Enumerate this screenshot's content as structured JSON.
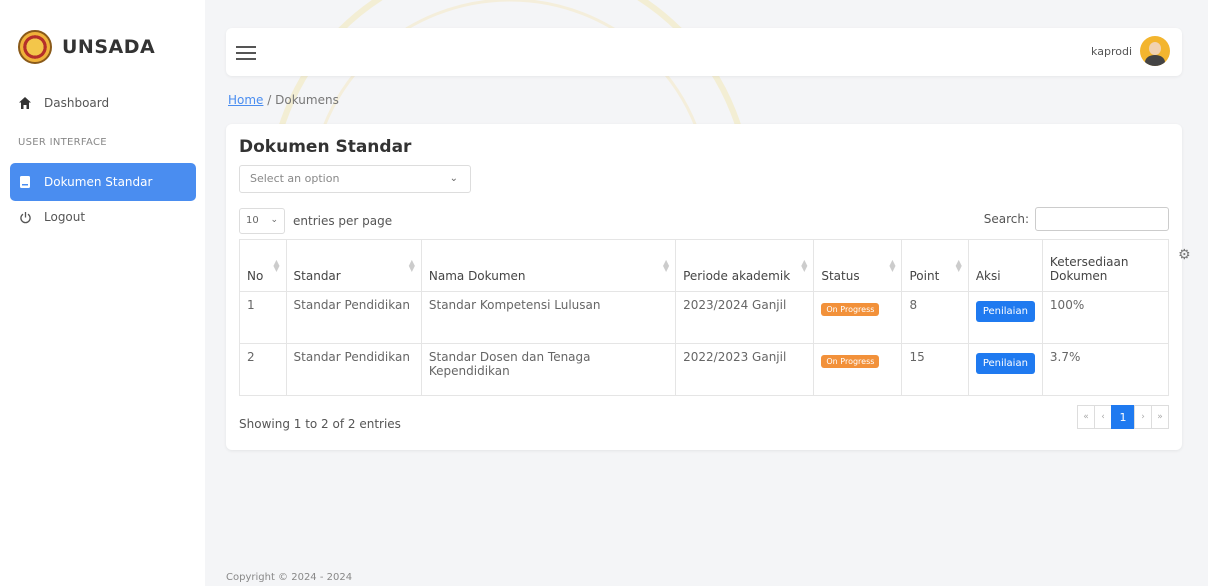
{
  "sidebar": {
    "brand": "UNSADA",
    "items": [
      {
        "label": "Dashboard"
      },
      {
        "label": "Dokumen Standar"
      },
      {
        "label": "Logout"
      }
    ],
    "section": "USER INTERFACE"
  },
  "topbar": {
    "user": "kaprodi"
  },
  "breadcrumb": {
    "home": "Home",
    "current": "Dokumens"
  },
  "card": {
    "title": "Dokumen Standar",
    "select_placeholder": "Select an option",
    "entries_value": "10",
    "entries_label": "entries per page",
    "search_label": "Search:"
  },
  "table": {
    "headers": [
      "No",
      "Standar",
      "Nama Dokumen",
      "Periode akademik",
      "Status",
      "Point",
      "Aksi",
      "Ketersediaan Dokumen"
    ],
    "rows": [
      {
        "no": "1",
        "standar": "Standar Pendidikan",
        "nama": "Standar Kompetensi Lulusan",
        "periode": "2023/2024 Ganjil",
        "status": "On Progress",
        "point": "8",
        "aksi": "Penilaian",
        "ketersediaan": "100%"
      },
      {
        "no": "2",
        "standar": "Standar Pendidikan",
        "nama": "Standar Dosen dan Tenaga Kependidikan",
        "periode": "2022/2023 Ganjil",
        "status": "On Progress",
        "point": "15",
        "aksi": "Penilaian",
        "ketersediaan": "3.7%"
      }
    ]
  },
  "pagination": {
    "showing": "Showing 1 to 2 of 2 entries",
    "first": "«",
    "prev": "‹",
    "current": "1",
    "next": "›",
    "last": "»"
  },
  "footer": {
    "text": "Copyright © 2024 - 2024"
  },
  "colors": {
    "accent": "#4a8df0",
    "button": "#1f7af0",
    "badge": "#f2913a"
  }
}
